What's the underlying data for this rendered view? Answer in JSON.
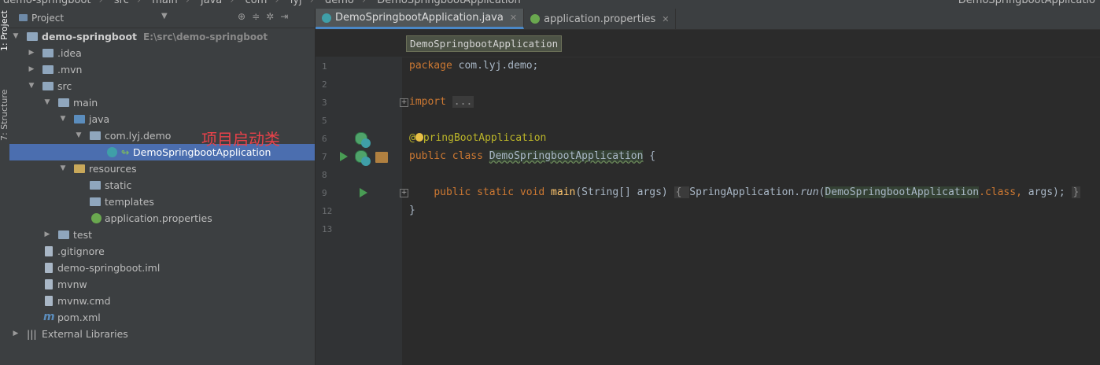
{
  "breadcrumb": {
    "items": [
      "demo-springboot",
      "src",
      "main",
      "java",
      "com",
      "lyj",
      "demo",
      "DemoSpringbootApplication"
    ],
    "right": "DemoSpringbootApplicatio"
  },
  "toolstrip": {
    "project_tab": "1: Project",
    "structure_tab": "7: Structure"
  },
  "project_panel": {
    "title": "Project",
    "tree": [
      {
        "label": "demo-springboot",
        "path": "E:\\src\\demo-springboot"
      },
      {
        "label": ".idea"
      },
      {
        "label": ".mvn"
      },
      {
        "label": "src"
      },
      {
        "label": "main"
      },
      {
        "label": "java"
      },
      {
        "label": "com.lyj.demo"
      },
      {
        "label": "DemoSpringbootApplication"
      },
      {
        "label": "resources"
      },
      {
        "label": "static"
      },
      {
        "label": "templates"
      },
      {
        "label": "application.properties"
      },
      {
        "label": "test"
      },
      {
        "label": ".gitignore"
      },
      {
        "label": "demo-springboot.iml"
      },
      {
        "label": "mvnw"
      },
      {
        "label": "mvnw.cmd"
      },
      {
        "label": "pom.xml"
      },
      {
        "label": "External Libraries"
      }
    ],
    "annotation": "项目启动类"
  },
  "editor": {
    "tabs": [
      {
        "label": "DemoSpringbootApplication.java",
        "active": true
      },
      {
        "label": "application.properties",
        "active": false
      }
    ],
    "breadcrumb": "DemoSpringbootApplication",
    "line_numbers": [
      "1",
      "2",
      "3",
      "5",
      "6",
      "7",
      "8",
      "9",
      "12",
      "13"
    ],
    "code": {
      "l1_kw": "package",
      "l1_rest": " com.lyj.demo;",
      "l3_kw": "import",
      "l3_fold": "...",
      "l6_at": "@",
      "l6_ann": "pringBootApplication",
      "l7_kw1": "public",
      "l7_kw2": "class",
      "l7_name": "DemoSpringbootApplication",
      "l7_rest": " {",
      "l9_kw1": "public",
      "l9_kw2": "static",
      "l9_kw3": "void",
      "l9_fn": "main",
      "l9_params": "(String[] args) ",
      "l9_body_open": "{ ",
      "l9_call_a": "SpringApplication.",
      "l9_call_run": "run",
      "l9_call_b": "(",
      "l9_arg_class": "DemoSpringbootApplication",
      "l9_dot_class": ".class, ",
      "l9_args": "args); ",
      "l9_close": "}",
      "l12": "}"
    }
  },
  "colors": {
    "keyword": "#cc7832",
    "annotation": "#bbb529",
    "selection": "#4b6eaf",
    "annotation_red": "#e8424a"
  }
}
